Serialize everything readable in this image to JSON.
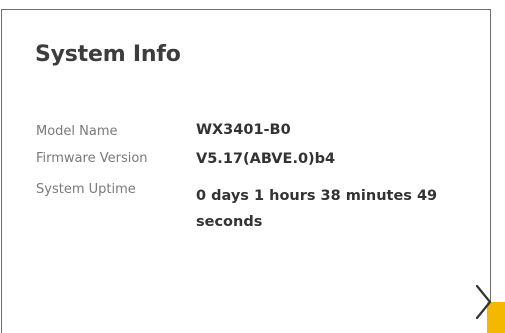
{
  "card": {
    "title": "System Info",
    "rows": [
      {
        "label": "Model Name",
        "value": "WX3401-B0"
      },
      {
        "label": "Firmware Version",
        "value": "V5.17(ABVE.0)b4"
      },
      {
        "label": "System Uptime",
        "value": "0 days 1 hours 38 minutes 49 seconds"
      }
    ]
  },
  "icons": {
    "next": "chevron-right-icon"
  },
  "colors": {
    "accent": "#f5b800",
    "border": "#6e6e6e",
    "title": "#3d3d3d",
    "label": "#7a7a7a",
    "value": "#333333"
  }
}
